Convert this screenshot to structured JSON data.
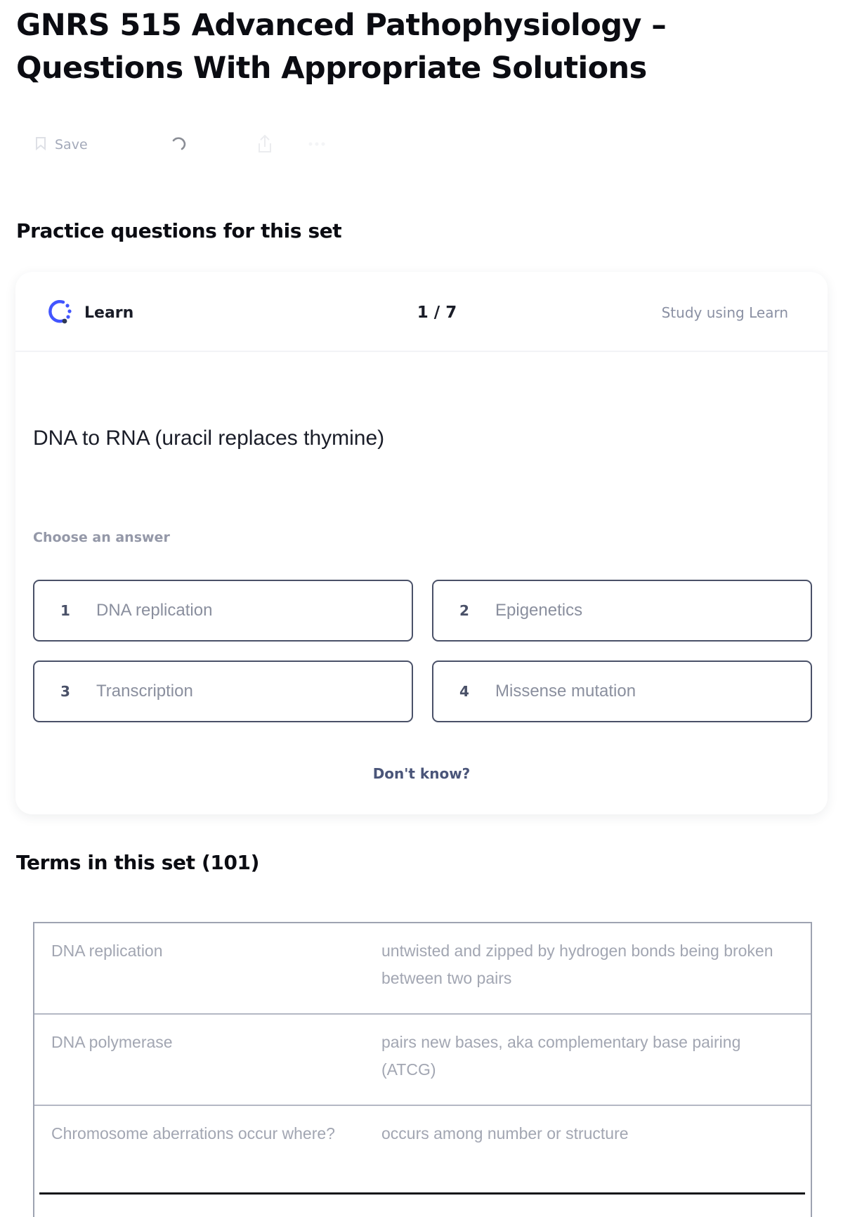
{
  "page": {
    "title": "GNRS 515 Advanced Pathophysiology – Questions With Appropriate Solutions"
  },
  "toolbar": {
    "save_label": "Save",
    "icons": [
      "bookmark-icon",
      "loading-spinner-icon",
      "share-icon",
      "more-icon"
    ]
  },
  "practice": {
    "heading": "Practice questions for this set",
    "mode_label": "Learn",
    "progress": "1 / 7",
    "study_link": "Study using Learn",
    "question": "DNA to RNA (uracil replaces thymine)",
    "choose_label": "Choose an answer",
    "options": [
      {
        "number": "1",
        "text": "DNA replication"
      },
      {
        "number": "2",
        "text": "Epigenetics"
      },
      {
        "number": "3",
        "text": "Transcription"
      },
      {
        "number": "4",
        "text": "Missense mutation"
      }
    ],
    "dont_know": "Don't know?"
  },
  "terms": {
    "heading": "Terms in this set (101)",
    "rows": [
      {
        "term": "DNA replication",
        "definition": "untwisted and zipped by hydrogen bonds being broken between two pairs"
      },
      {
        "term": "DNA polymerase",
        "definition": "pairs new bases, aka complementary base pairing (ATCG)"
      },
      {
        "term": "Chromosome aberrations occur where?",
        "definition": "occurs among number or structure"
      }
    ]
  },
  "colors": {
    "accent": "#4255ff",
    "option_border": "#4a5168",
    "muted_text": "#a2a6b2"
  }
}
